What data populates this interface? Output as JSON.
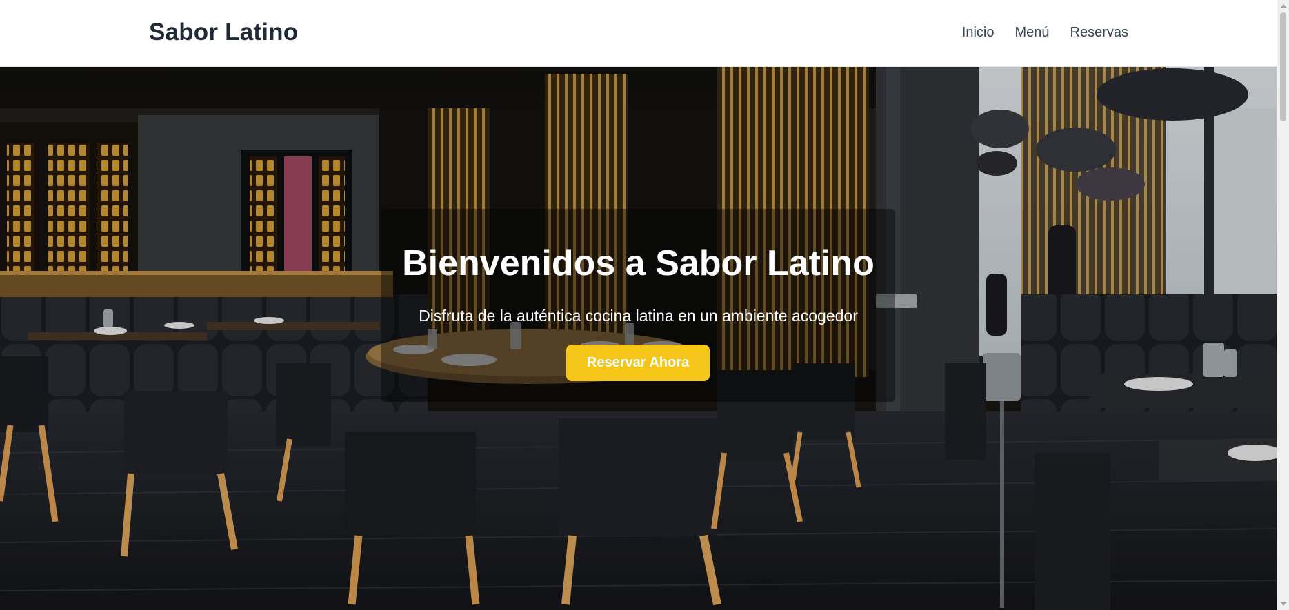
{
  "header": {
    "brand": "Sabor Latino",
    "nav": [
      "Inicio",
      "Menú",
      "Reservas"
    ]
  },
  "hero": {
    "title": "Bienvenidos a Sabor Latino",
    "subtitle": "Disfruta de la auténtica cocina latina en un ambiente acogedor",
    "cta_label": "Reservar Ahora",
    "background": "restaurant-interior-photo"
  },
  "colors": {
    "accent": "#f5c518",
    "brand_text": "#1f2937",
    "nav_text": "#374151"
  }
}
